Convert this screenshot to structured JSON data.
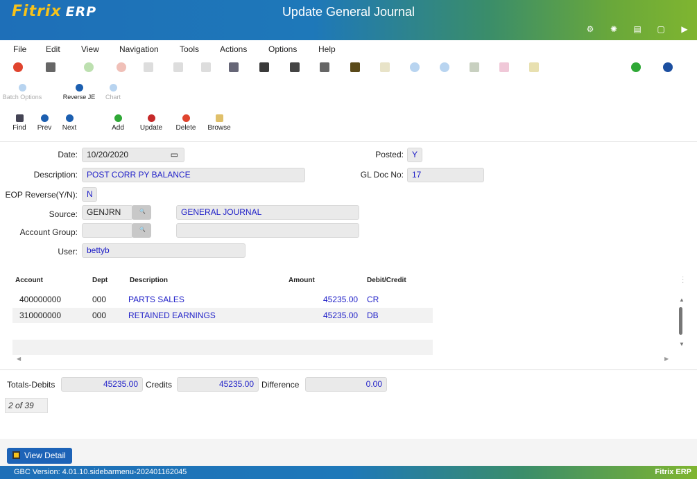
{
  "app": {
    "logo_main": "Fitrix",
    "logo_sub": "ERP",
    "window_title": "Update General Journal",
    "header_icons": [
      "gear-icon",
      "globe-icon",
      "document-icon",
      "page-icon",
      "play-icon"
    ]
  },
  "menu": [
    "File",
    "Edit",
    "View",
    "Navigation",
    "Tools",
    "Actions",
    "Options",
    "Help"
  ],
  "secondary_actions": [
    {
      "label": "Batch Options",
      "enabled": false
    },
    {
      "label": "Reverse JE",
      "enabled": true
    },
    {
      "label": "Chart",
      "enabled": false
    }
  ],
  "actions": [
    {
      "label": "Find",
      "icon": "search-icon"
    },
    {
      "label": "Prev",
      "icon": "prev-icon"
    },
    {
      "label": "Next",
      "icon": "next-icon"
    },
    {
      "label": "Add",
      "icon": "add-icon"
    },
    {
      "label": "Update",
      "icon": "update-icon"
    },
    {
      "label": "Delete",
      "icon": "delete-icon"
    },
    {
      "label": "Browse",
      "icon": "browse-icon"
    }
  ],
  "form": {
    "date_label": "Date:",
    "date_value": "10/20/2020",
    "posted_label": "Posted:",
    "posted_value": "Y",
    "description_label": "Description:",
    "description_value": "POST CORR PY BALANCE",
    "gl_doc_label": "GL Doc No:",
    "gl_doc_value": "17",
    "eop_label": "EOP Reverse(Y/N):",
    "eop_value": "N",
    "source_label": "Source:",
    "source_value": "GENJRN",
    "source_desc": "GENERAL JOURNAL",
    "account_group_label": "Account Group:",
    "account_group_value": "",
    "account_group_desc": "",
    "user_label": "User:",
    "user_value": "bettyb"
  },
  "table": {
    "headers": {
      "account": "Account",
      "dept": "Dept",
      "description": "Description",
      "amount": "Amount",
      "debit_credit": "Debit/Credit"
    },
    "rows": [
      {
        "account": "400000000",
        "dept": "000",
        "description": "PARTS SALES",
        "amount": "45235.00",
        "dc": "CR"
      },
      {
        "account": "310000000",
        "dept": "000",
        "description": "RETAINED EARNINGS",
        "amount": "45235.00",
        "dc": "DB"
      }
    ]
  },
  "totals": {
    "debits_label": "Totals-Debits",
    "debits_value": "45235.00",
    "credits_label": "Credits",
    "credits_value": "45235.00",
    "difference_label": "Difference",
    "difference_value": "0.00"
  },
  "record_counter": "2 of 39",
  "view_detail_label": "View Detail",
  "footer": {
    "version": "GBC Version: 4.01.10.sidebarmenu-202401162045",
    "brand": "Fitrix ERP"
  }
}
